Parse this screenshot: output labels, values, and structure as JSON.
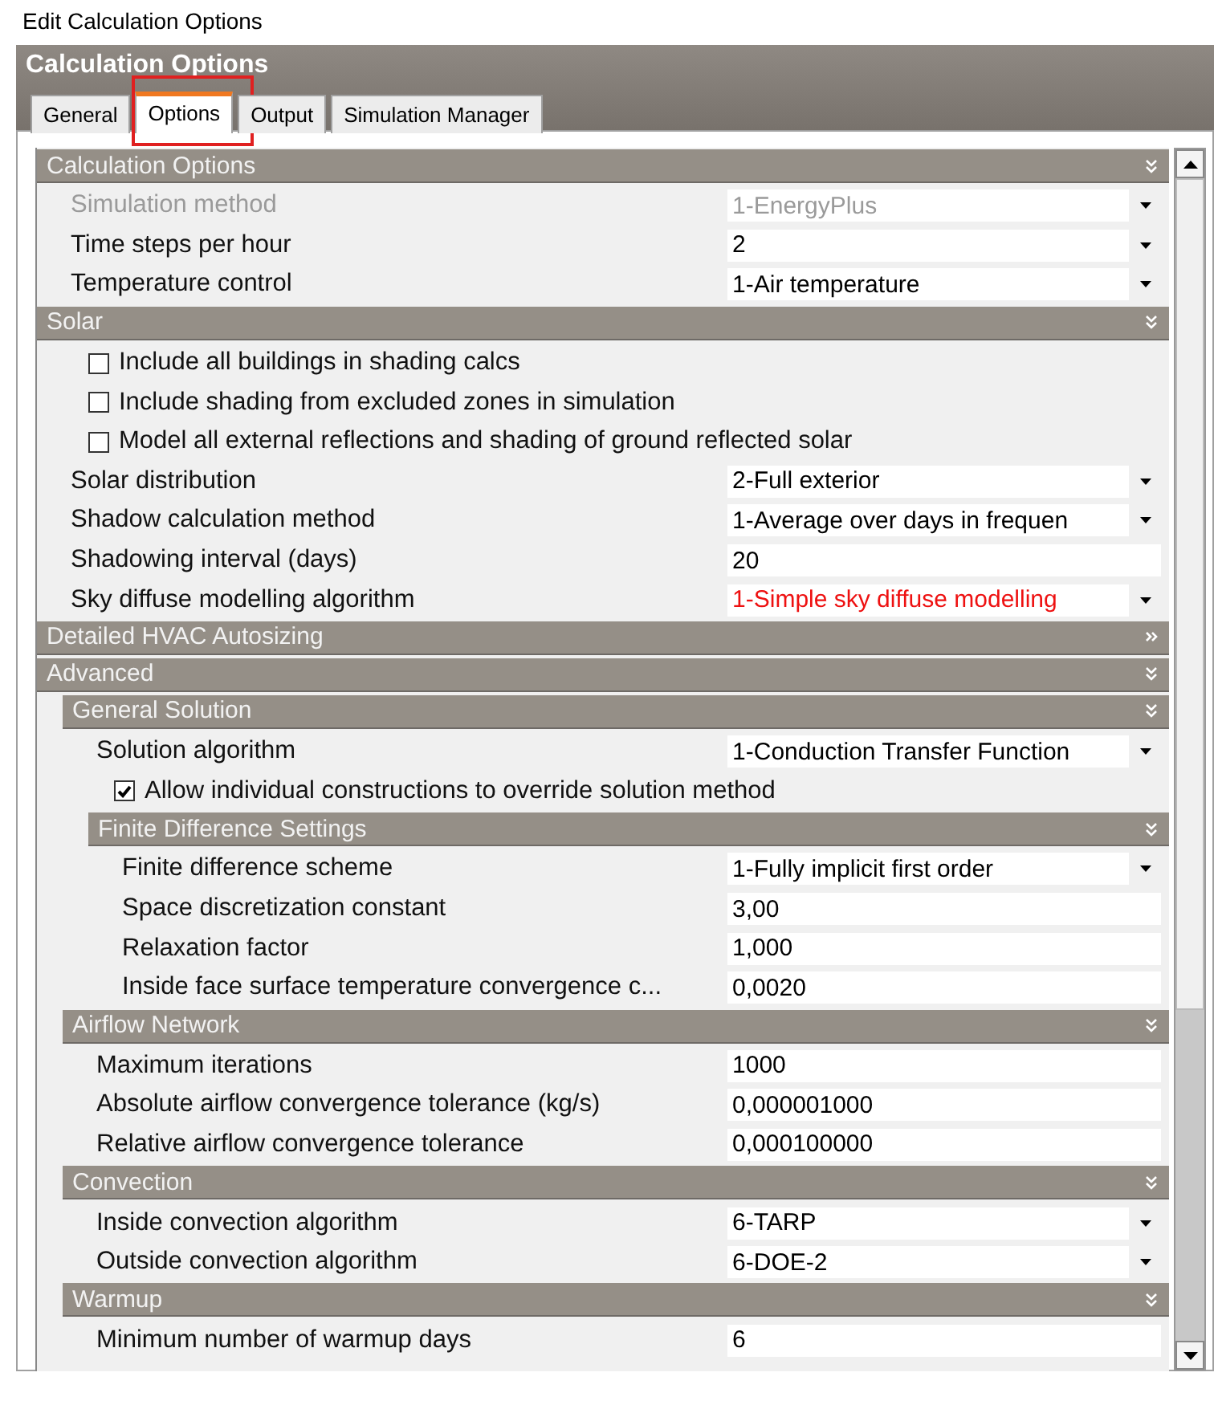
{
  "window": {
    "title": "Edit Calculation Options"
  },
  "panel": {
    "title": "Calculation Options"
  },
  "tabs": [
    {
      "label": "General",
      "selected": false,
      "highlighted": false
    },
    {
      "label": "Options",
      "selected": true,
      "highlighted": true
    },
    {
      "label": "Output",
      "selected": false,
      "highlighted": false
    },
    {
      "label": "Simulation Manager",
      "selected": false,
      "highlighted": false
    }
  ],
  "sections": [
    {
      "kind": "section",
      "title": "Calculation Options",
      "expanded": true,
      "items": [
        {
          "kind": "dropdown",
          "label": "Simulation method",
          "value": "1-EnergyPlus",
          "disabled": true
        },
        {
          "kind": "dropdown",
          "label": "Time steps per hour",
          "value": "2"
        },
        {
          "kind": "dropdown",
          "label": "Temperature control",
          "value": "1-Air temperature"
        }
      ]
    },
    {
      "kind": "section",
      "title": "Solar",
      "expanded": true,
      "items": [
        {
          "kind": "checkbox",
          "label": "Include all buildings in shading calcs",
          "checked": false
        },
        {
          "kind": "checkbox",
          "label": "Include shading from excluded zones in simulation",
          "checked": false
        },
        {
          "kind": "checkbox",
          "label": "Model all external reflections and shading of ground reflected solar",
          "checked": false
        },
        {
          "kind": "dropdown",
          "label": "Solar distribution",
          "value": "2-Full exterior"
        },
        {
          "kind": "dropdown",
          "label": "Shadow calculation method",
          "value": "1-Average over days in frequen"
        },
        {
          "kind": "text",
          "label": "Shadowing interval (days)",
          "value": "20"
        },
        {
          "kind": "dropdown",
          "label": "Sky diffuse modelling algorithm",
          "value": "1-Simple sky diffuse modelling",
          "color": "#ee1111"
        }
      ]
    },
    {
      "kind": "section",
      "title": "Detailed HVAC Autosizing",
      "expanded": false
    },
    {
      "kind": "section",
      "title": "Advanced",
      "expanded": true,
      "items": [
        {
          "kind": "section",
          "title": "General Solution",
          "expanded": true,
          "items": [
            {
              "kind": "dropdown",
              "label": "Solution algorithm",
              "value": "1-Conduction Transfer Function"
            },
            {
              "kind": "checkbox",
              "label": "Allow individual constructions to override solution method",
              "checked": true
            },
            {
              "kind": "section",
              "title": "Finite Difference Settings",
              "expanded": true,
              "items": [
                {
                  "kind": "dropdown",
                  "label": "Finite difference scheme",
                  "value": "1-Fully implicit first order"
                },
                {
                  "kind": "text",
                  "label": "Space discretization constant",
                  "value": "3,00"
                },
                {
                  "kind": "text",
                  "label": "Relaxation factor",
                  "value": "1,000"
                },
                {
                  "kind": "text",
                  "label": "Inside face surface temperature convergence c...",
                  "value": "0,0020"
                }
              ]
            }
          ]
        },
        {
          "kind": "section",
          "title": "Airflow Network",
          "expanded": true,
          "items": [
            {
              "kind": "text",
              "label": "Maximum iterations",
              "value": "1000"
            },
            {
              "kind": "text",
              "label": "Absolute airflow convergence tolerance (kg/s)",
              "value": "0,000001000"
            },
            {
              "kind": "text",
              "label": "Relative airflow convergence tolerance",
              "value": "0,000100000"
            }
          ]
        },
        {
          "kind": "section",
          "title": "Convection",
          "expanded": true,
          "items": [
            {
              "kind": "dropdown",
              "label": "Inside convection algorithm",
              "value": "6-TARP"
            },
            {
              "kind": "dropdown",
              "label": "Outside convection algorithm",
              "value": "6-DOE-2"
            }
          ]
        },
        {
          "kind": "section",
          "title": "Warmup",
          "expanded": true,
          "items": [
            {
              "kind": "text",
              "label": "Minimum number of warmup days",
              "value": "6"
            }
          ]
        }
      ]
    }
  ]
}
